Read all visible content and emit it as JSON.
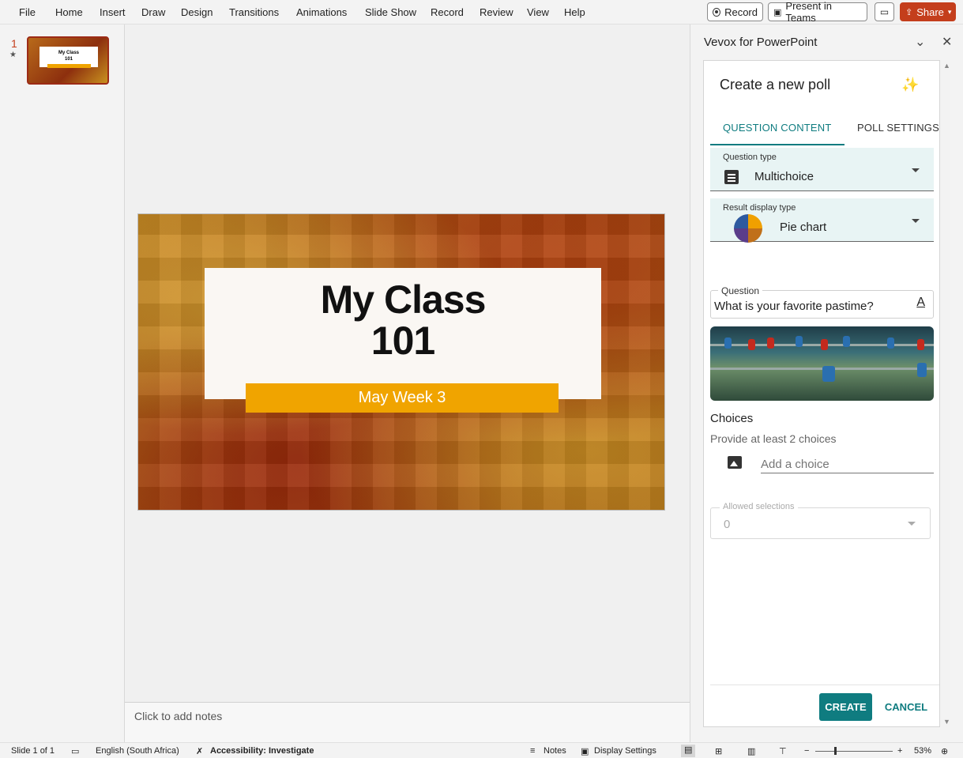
{
  "menu": [
    "File",
    "Home",
    "Insert",
    "Draw",
    "Design",
    "Transitions",
    "Animations",
    "Slide Show",
    "Record",
    "Review",
    "View",
    "Help"
  ],
  "toolbar": {
    "record_label": "Record",
    "teams_label": "Present in Teams",
    "share_label": "Share",
    "share_color": "#c43e1c"
  },
  "thumbnails": {
    "slide_number": "1",
    "star": "★",
    "thumb_title": "My Class\n101"
  },
  "slide": {
    "title": "My Class\n101",
    "subtitle": "May Week 3",
    "subtitle_bar_color": "#f0a400"
  },
  "notes": {
    "placeholder": "Click to add notes"
  },
  "taskpane": {
    "title": "Vevox for PowerPoint",
    "collapse_icon": "chevron-down-icon",
    "close_icon": "close-icon"
  },
  "poll": {
    "title": "Create a new poll",
    "tabs": [
      "QUESTION CONTENT",
      "POLL SETTINGS"
    ],
    "accent_color": "#0f7c80",
    "question_type": {
      "label": "Question type",
      "value": "Multichoice"
    },
    "result_display": {
      "label": "Result display type",
      "value": "Pie chart"
    },
    "question": {
      "label": "Question",
      "value": "What is your favorite pastime?"
    },
    "choices": {
      "heading": "Choices",
      "hint": "Provide at least 2 choices",
      "placeholder": "Add a choice"
    },
    "allowed_selections": {
      "label": "Allowed selections",
      "value": "0"
    },
    "create_label": "CREATE",
    "cancel_label": "CANCEL"
  },
  "status": {
    "slide_info": "Slide 1 of 1",
    "language": "English (South Africa)",
    "accessibility": "Accessibility: Investigate",
    "notes_label": "Notes",
    "display_settings": "Display Settings",
    "zoom_level": "53%",
    "zoom_fraction": 0.25
  }
}
